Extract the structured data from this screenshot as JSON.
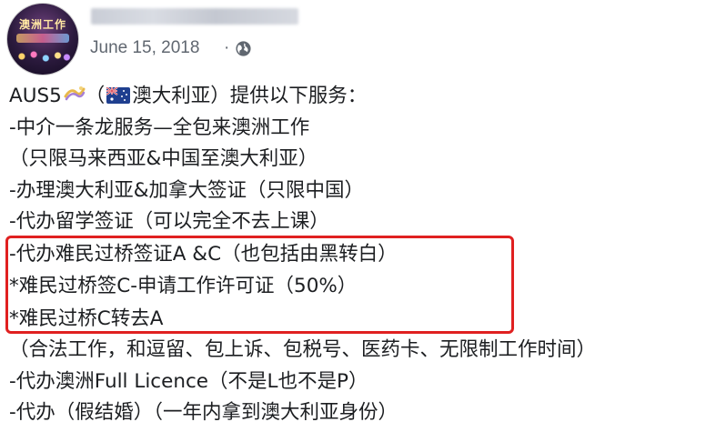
{
  "post": {
    "avatar_text": "澳洲工作",
    "date": "June 15, 2018",
    "separator": "·",
    "privacy_icon": "globe-icon"
  },
  "content": {
    "line1_prefix": "AUS5",
    "line1_mid": "（",
    "line1_suffix": "澳大利亚）提供以下服务：",
    "line2": "-中介一条龙服务—全包来澳洲工作",
    "line3": "（只限马来西亚&中国至澳大利亚）",
    "line4": "-办理澳大利亚&加拿大签证（只限中国）",
    "line5": "-代办留学签证（可以完全不去上课）",
    "line6": "-代办难民过桥签证A &C（也包括由黑转白）",
    "line7": "*难民过桥签C-申请工作许可证（50%）",
    "line8": "*难民过桥C转去A",
    "line9": "（合法工作，和逗留、包上诉、包税号、医药卡、无限制工作时间）",
    "line10": "-代办澳洲Full Licence（不是L也不是P）",
    "line11": "-代办（假结婚）（一年内拿到澳大利亚身份）"
  },
  "colors": {
    "highlight_border": "#e02020",
    "meta_text": "#606770",
    "body_text": "#1c1e21"
  }
}
